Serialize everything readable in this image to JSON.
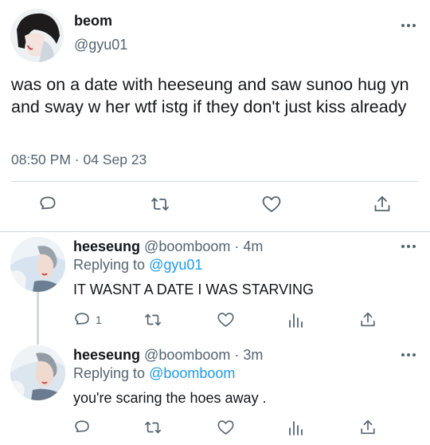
{
  "main_tweet": {
    "display_name": "beom",
    "handle": "@gyu01",
    "text": "was on a date with heeseung and saw sunoo hug yn and sway w her wtf istg if they don't just kiss already",
    "time": "08:50 PM",
    "separator": "·",
    "date": "04 Sep 23"
  },
  "replies": [
    {
      "display_name": "heeseung",
      "handle": "@boomboom",
      "separator": "·",
      "age": "4m",
      "replying_prefix": "Replying to",
      "replying_to": "@gyu01",
      "text": "IT WASNT A DATE I WAS STARVING",
      "reply_count": "1"
    },
    {
      "display_name": "heeseung",
      "handle": "@boomboom",
      "separator": "·",
      "age": "3m",
      "replying_prefix": "Replying to",
      "replying_to": "@boomboom",
      "text": "you're scaring the hoes away ."
    }
  ],
  "colors": {
    "text": "#14171a",
    "secondary": "#536471",
    "link": "#1d9bf0",
    "divider": "#cfd9de"
  },
  "icons": [
    "more-dots-icon",
    "reply-icon",
    "retweet-icon",
    "like-icon",
    "analytics-icon",
    "share-icon"
  ]
}
